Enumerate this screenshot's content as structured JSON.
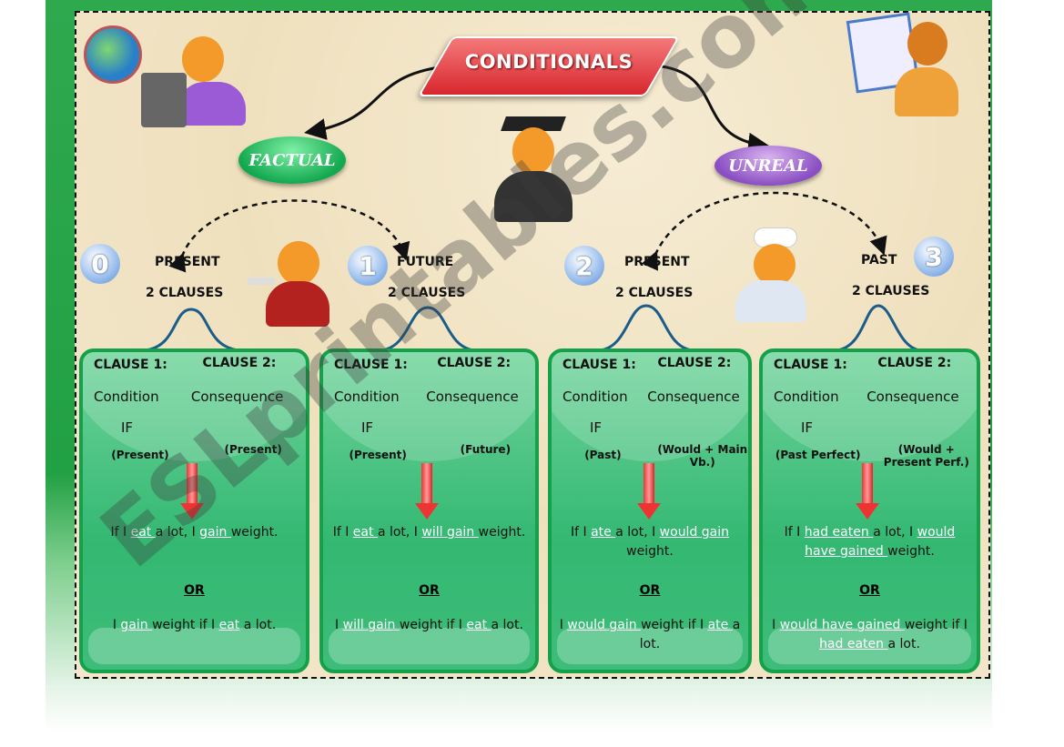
{
  "title": "CONDITIONALS",
  "branches": {
    "left": "FACTUAL",
    "right": "UNREAL"
  },
  "columns": [
    {
      "number": "0",
      "tense": "PRESENT",
      "clauses": "2 CLAUSES",
      "clause1": "CLAUSE 1:",
      "clause2": "CLAUSE 2:",
      "condition": "Condition",
      "consequence": "Consequence",
      "if": "IF",
      "c1_tense": "(Present)",
      "c2_tense": "(Present)",
      "example1": [
        {
          "t": "If I "
        },
        {
          "t": "eat ",
          "u": true
        },
        {
          "t": "a lot, I "
        },
        {
          "t": "gain ",
          "u": true
        },
        {
          "t": "weight."
        }
      ],
      "or": "OR",
      "example2": [
        {
          "t": "I "
        },
        {
          "t": "gain ",
          "u": true
        },
        {
          "t": "weight if I "
        },
        {
          "t": "eat",
          "u": true
        },
        {
          "t": " a lot."
        }
      ]
    },
    {
      "number": "1",
      "tense": "FUTURE",
      "clauses": "2 CLAUSES",
      "clause1": "CLAUSE 1:",
      "clause2": "CLAUSE 2:",
      "condition": "Condition",
      "consequence": "Consequence",
      "if": "IF",
      "c1_tense": "(Present)",
      "c2_tense": "(Future)",
      "example1": [
        {
          "t": "If I "
        },
        {
          "t": "eat ",
          "u": true
        },
        {
          "t": "a lot, I "
        },
        {
          "t": "will gain ",
          "u": true
        },
        {
          "t": "weight."
        }
      ],
      "or": "OR",
      "example2": [
        {
          "t": "I "
        },
        {
          "t": "will gain ",
          "u": true
        },
        {
          "t": "weight if I "
        },
        {
          "t": "eat ",
          "u": true
        },
        {
          "t": "a lot."
        }
      ]
    },
    {
      "number": "2",
      "tense": "PRESENT",
      "clauses": "2 CLAUSES",
      "clause1": "CLAUSE 1:",
      "clause2": "CLAUSE 2:",
      "condition": "Condition",
      "consequence": "Consequence",
      "if": "IF",
      "c1_tense": "(Past)",
      "c2_tense": "(Would + Main Vb.)",
      "example1": [
        {
          "t": "If I "
        },
        {
          "t": "ate ",
          "u": true
        },
        {
          "t": "a lot, I "
        },
        {
          "t": "would gain ",
          "u": true
        },
        {
          "t": "weight."
        }
      ],
      "or": "OR",
      "example2": [
        {
          "t": "I "
        },
        {
          "t": "would gain ",
          "u": true
        },
        {
          "t": "weight if I "
        },
        {
          "t": "ate ",
          "u": true
        },
        {
          "t": "a lot."
        }
      ]
    },
    {
      "number": "3",
      "tense": "PAST",
      "clauses": "2 CLAUSES",
      "clause1": "CLAUSE 1:",
      "clause2": "CLAUSE 2:",
      "condition": "Condition",
      "consequence": "Consequence",
      "if": "IF",
      "c1_tense": "(Past Perfect)",
      "c2_tense": "(Would + Present Perf.)",
      "example1": [
        {
          "t": "If I "
        },
        {
          "t": "had eaten ",
          "u": true
        },
        {
          "t": " a lot, I "
        },
        {
          "t": "would have gained ",
          "u": true
        },
        {
          "t": "weight."
        }
      ],
      "or": "OR",
      "example2": [
        {
          "t": "I "
        },
        {
          "t": "would have gained ",
          "u": true
        },
        {
          "t": " weight if I "
        },
        {
          "t": "had eaten ",
          "u": true
        },
        {
          "t": "a lot."
        }
      ]
    }
  ],
  "watermark": "ESLprintables.com",
  "colors": {
    "frame": "#22a044",
    "title": "#d8262e",
    "factual": "#14a950",
    "unreal": "#8a4fc2",
    "box": "#33b872",
    "underline": "#ffffff"
  }
}
